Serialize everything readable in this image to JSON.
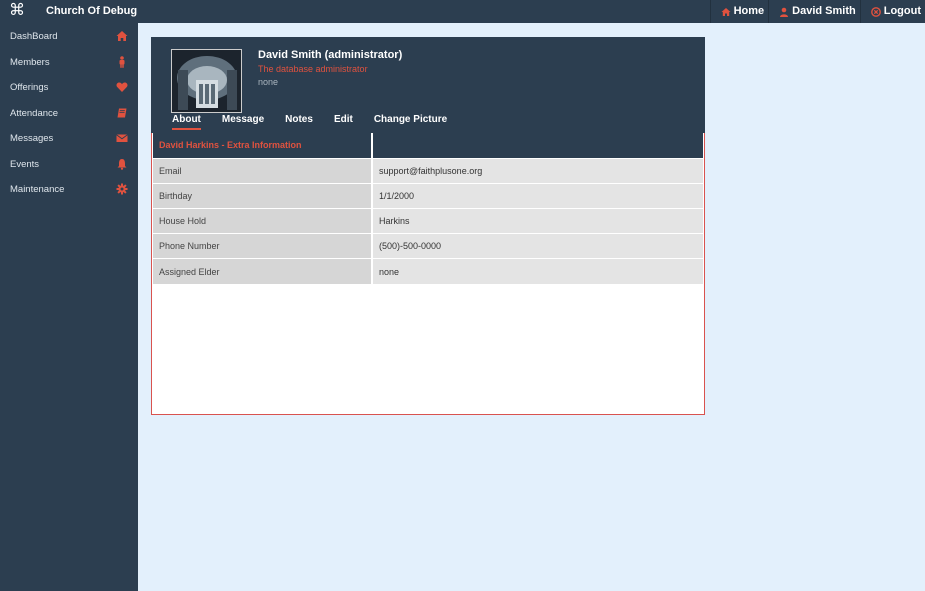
{
  "topbar": {
    "brand_icon": "command-icon",
    "title": "Church Of Debug",
    "nav": [
      {
        "label": "Home",
        "icon": "home-icon"
      },
      {
        "label": "David Smith",
        "icon": "user-icon"
      },
      {
        "label": "Logout",
        "icon": "close-circle-icon"
      }
    ]
  },
  "sidebar": {
    "items": [
      {
        "label": "DashBoard",
        "icon": "home-icon"
      },
      {
        "label": "Members",
        "icon": "person-icon"
      },
      {
        "label": "Offerings",
        "icon": "heart-icon"
      },
      {
        "label": "Attendance",
        "icon": "book-icon"
      },
      {
        "label": "Messages",
        "icon": "envelope-icon"
      },
      {
        "label": "Events",
        "icon": "bell-icon"
      },
      {
        "label": "Maintenance",
        "icon": "gear-icon"
      }
    ]
  },
  "profile": {
    "name": "David Smith (administrator)",
    "role": "The database administrator",
    "extra": "none",
    "tabs": [
      "About",
      "Message",
      "Notes",
      "Edit",
      "Change Picture"
    ],
    "active_tab": "About"
  },
  "info": {
    "header": "David Harkins - Extra Information",
    "rows": [
      {
        "label": "Email",
        "value": "support@faithplusone.org"
      },
      {
        "label": "Birthday",
        "value": "1/1/2000"
      },
      {
        "label": "House Hold",
        "value": "Harkins"
      },
      {
        "label": "Phone Number",
        "value": "(500)-500-0000"
      },
      {
        "label": "Assigned Elder",
        "value": "none"
      }
    ]
  },
  "colors": {
    "navbar": "#2c3e50",
    "accent": "#e0523f",
    "background": "#e3f0fc"
  }
}
